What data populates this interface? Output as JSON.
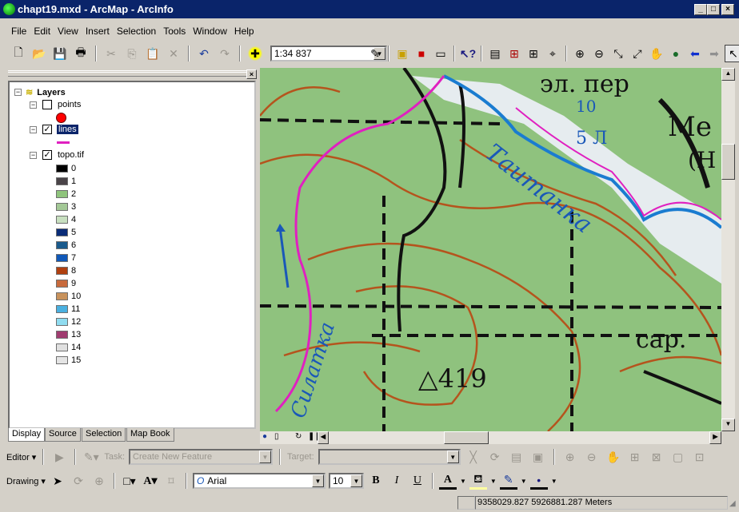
{
  "window": {
    "title": "chapt19.mxd - ArcMap - ArcInfo"
  },
  "menu": [
    "File",
    "Edit",
    "View",
    "Insert",
    "Selection",
    "Tools",
    "Window",
    "Help"
  ],
  "standard_toolbar": {
    "scale": "1:34 837",
    "icons": [
      "new-icon",
      "open-icon",
      "save-icon",
      "print-icon",
      "cut-icon",
      "copy-icon",
      "paste-icon",
      "delete-icon",
      "undo-icon",
      "redo-icon",
      "add-data-icon"
    ]
  },
  "tools_toolbar": {
    "icons": [
      "editor-toolbar-icon",
      "arccatalog-icon",
      "arctoolbox-icon",
      "command-line-icon",
      "whats-this-icon",
      "magnifier-icon",
      "overview-icon",
      "viewer-icon",
      "identify-icon",
      "zoom-in-icon",
      "zoom-out-icon",
      "fixed-zoom-in-icon",
      "fixed-zoom-out-icon",
      "pan-icon",
      "full-extent-icon",
      "back-icon",
      "forward-icon",
      "select-features-icon"
    ]
  },
  "toc": {
    "root": "Layers",
    "layers": [
      {
        "name": "points",
        "checked": false,
        "symbol_color": "#ff0000"
      },
      {
        "name": "lines",
        "checked": true,
        "selected": true,
        "symbol_color": "#e020c0"
      },
      {
        "name": "topo.tif",
        "checked": true
      }
    ],
    "classes": [
      {
        "label": "0",
        "color": "#000000"
      },
      {
        "label": "1",
        "color": "#4a4448"
      },
      {
        "label": "2",
        "color": "#8fc47c"
      },
      {
        "label": "3",
        "color": "#a3c896"
      },
      {
        "label": "4",
        "color": "#c8e0c0"
      },
      {
        "label": "5",
        "color": "#0a2c78"
      },
      {
        "label": "6",
        "color": "#1a5a8c"
      },
      {
        "label": "7",
        "color": "#1058b8"
      },
      {
        "label": "8",
        "color": "#b04010"
      },
      {
        "label": "9",
        "color": "#c86a3c"
      },
      {
        "label": "10",
        "color": "#c8925c"
      },
      {
        "label": "11",
        "color": "#4ab0e0"
      },
      {
        "label": "12",
        "color": "#90dcf0"
      },
      {
        "label": "13",
        "color": "#a03c70"
      },
      {
        "label": "14",
        "color": "#e0e0e0"
      },
      {
        "label": "15",
        "color": "#e4e4e4"
      }
    ],
    "tabs": [
      "Display",
      "Source",
      "Selection",
      "Map Book"
    ]
  },
  "map": {
    "labels": [
      "эл. пер",
      "10",
      "5 Л",
      "Ме",
      "(Н",
      "Таитанка",
      "Силатка",
      "△419",
      "сар."
    ]
  },
  "editor_toolbar": {
    "menu": "Editor",
    "task_label": "Task:",
    "task_value": "Create New Feature",
    "target_label": "Target:",
    "target_value": ""
  },
  "drawing_toolbar": {
    "menu": "Drawing",
    "font": "Arial",
    "size": "10",
    "bold": "B",
    "italic": "I",
    "underline": "U",
    "font_color_glyph": "A"
  },
  "status": {
    "coordinates": "9358029.827  5926881.287 Meters"
  }
}
